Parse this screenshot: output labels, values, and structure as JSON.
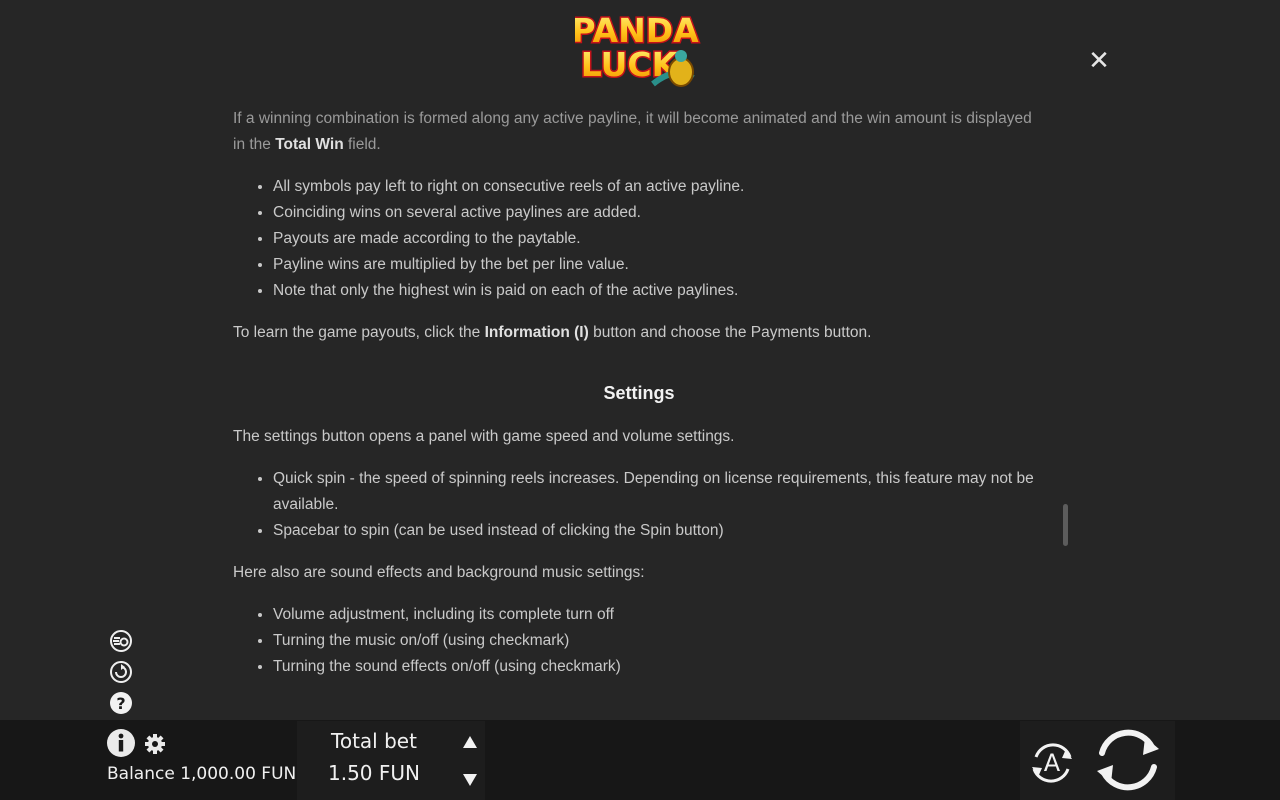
{
  "logo": {
    "line1": "PANDA",
    "line2": "LUCK"
  },
  "rules": {
    "intro": {
      "before": "If a winning combination is formed along any active payline, it will become animated and the win amount is displayed in the ",
      "bold": "Total Win",
      "after": " field."
    },
    "paylines": [
      "All symbols pay left to right on consecutive reels of an active payline.",
      "Coinciding wins on several active paylines are added.",
      "Payouts are made according to the paytable.",
      "Payline wins are multiplied by the bet per line value.",
      "Note that only the highest win is paid on each of the active paylines."
    ],
    "payouts_note": {
      "before": "To learn the game payouts, click the ",
      "bold": "Information (I)",
      "after": " button and choose the Payments button."
    },
    "settings_title": "Settings",
    "settings_intro": "The settings button opens a panel with game speed and volume settings.",
    "settings_items": [
      "Quick spin - the speed of spinning reels increases. Depending on license requirements, this feature may not be available.",
      "Spacebar to spin (can be used instead of clicking the Spin button)"
    ],
    "sound_intro": "Here also are sound effects and background music settings:",
    "sound_items": [
      "Volume adjustment, including its complete turn off",
      "Turning the music on/off (using checkmark)",
      "Turning the sound effects on/off (using checkmark)"
    ]
  },
  "bottom_bar": {
    "balance": "Balance 1,000.00 FUN",
    "total_bet_label": "Total bet",
    "total_bet_value": "1.50 FUN",
    "auto_label": "A"
  },
  "colors": {
    "background": "#262626",
    "bar": "#171717",
    "text": "#c9c9c9",
    "logo_yellow": "#ffd21a",
    "logo_red": "#d2141c"
  }
}
